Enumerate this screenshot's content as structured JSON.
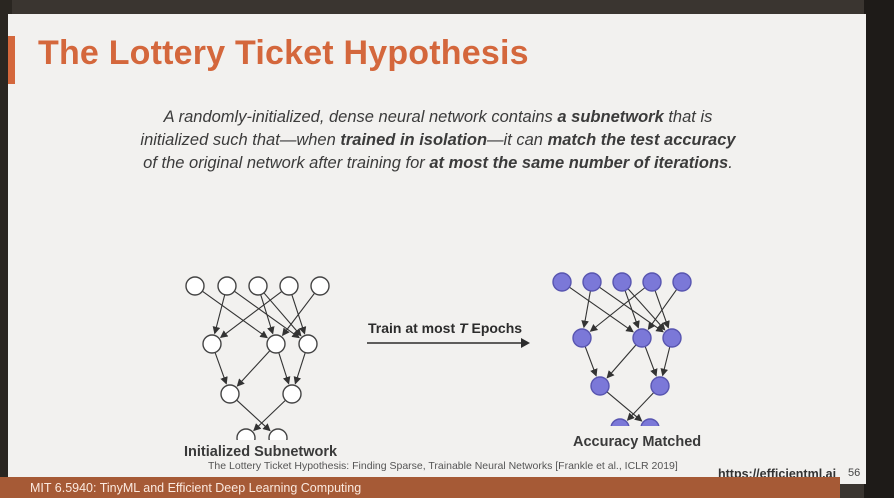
{
  "slide": {
    "title": "The Lottery Ticket Hypothesis",
    "quote_parts": [
      {
        "text": "A randomly-initialized, dense neural network contains ",
        "bold": false
      },
      {
        "text": "a subnetwork",
        "bold": true
      },
      {
        "text": " that is initialized such that—when ",
        "bold": false
      },
      {
        "text": "trained in isolation",
        "bold": true
      },
      {
        "text": "—it can ",
        "bold": false
      },
      {
        "text": "match the test accuracy",
        "bold": true
      },
      {
        "text": " of the original network after training for ",
        "bold": false
      },
      {
        "text": "at most the same number of iterations",
        "bold": true
      },
      {
        "text": ".",
        "bold": false
      }
    ],
    "arrow_label_prefix": "Train at most ",
    "arrow_label_var": "T",
    "arrow_label_suffix": " Epochs",
    "left_caption": "Initialized Subnetwork",
    "right_caption": "Accuracy Matched",
    "citation": "The Lottery Ticket Hypothesis: Finding Sparse, Trainable Neural Networks [Frankle et al., ICLR 2019]",
    "url": "https://efficientml.ai",
    "page_number": "56",
    "footer": "MIT 6.5940: TinyML and Efficient Deep Learning Computing"
  },
  "colors": {
    "title": "#d4673c",
    "footer_bar": "#a65a36",
    "node_trained": "#7b78d8",
    "node_initial": "#ffffff"
  }
}
